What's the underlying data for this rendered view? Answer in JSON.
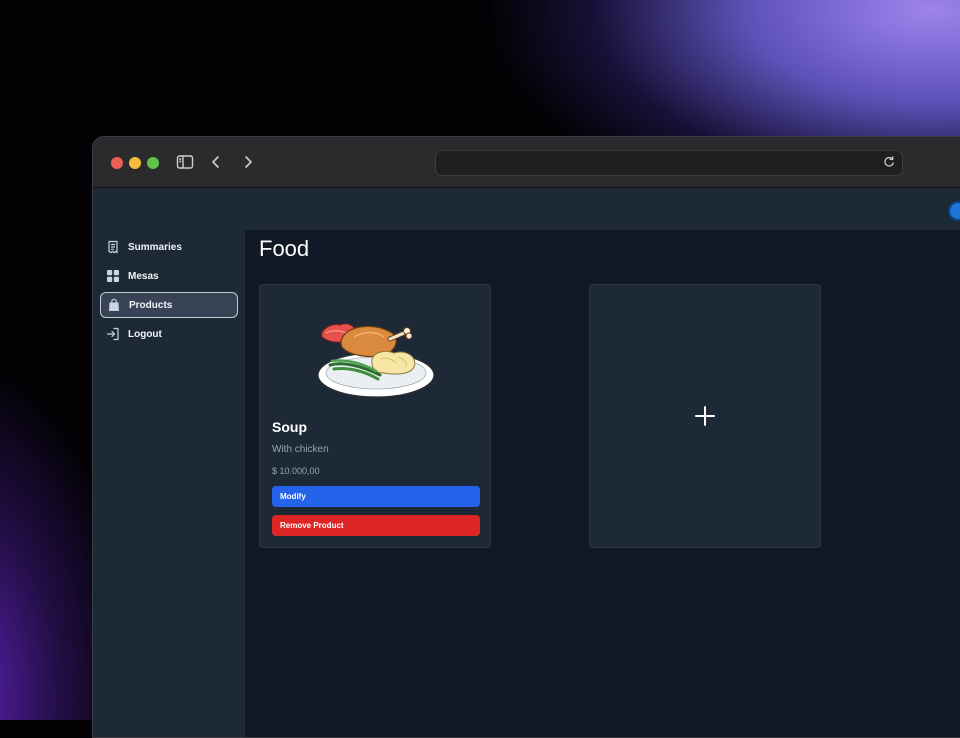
{
  "browser": {
    "address": "",
    "icons": [
      "sidebar-toggle-icon",
      "back-icon",
      "forward-icon",
      "reload-icon"
    ]
  },
  "sidebar": {
    "items": [
      {
        "label": "Summaries",
        "icon": "receipt-icon",
        "active": false
      },
      {
        "label": "Mesas",
        "icon": "grid-icon",
        "active": false
      },
      {
        "label": "Products",
        "icon": "bag-icon",
        "active": true
      },
      {
        "label": "Logout",
        "icon": "logout-icon",
        "active": false
      }
    ]
  },
  "main": {
    "title": "Food",
    "products": [
      {
        "name": "Soup",
        "description": "With chicken",
        "price": "$ 10.000,00",
        "modify_label": "Modify",
        "remove_label": "Remove Product"
      }
    ],
    "add_card_icon": "plus-icon"
  },
  "colors": {
    "primary": "#2563eb",
    "danger": "#dc2626",
    "background": "#111826",
    "sidebar": "#1e2936"
  }
}
